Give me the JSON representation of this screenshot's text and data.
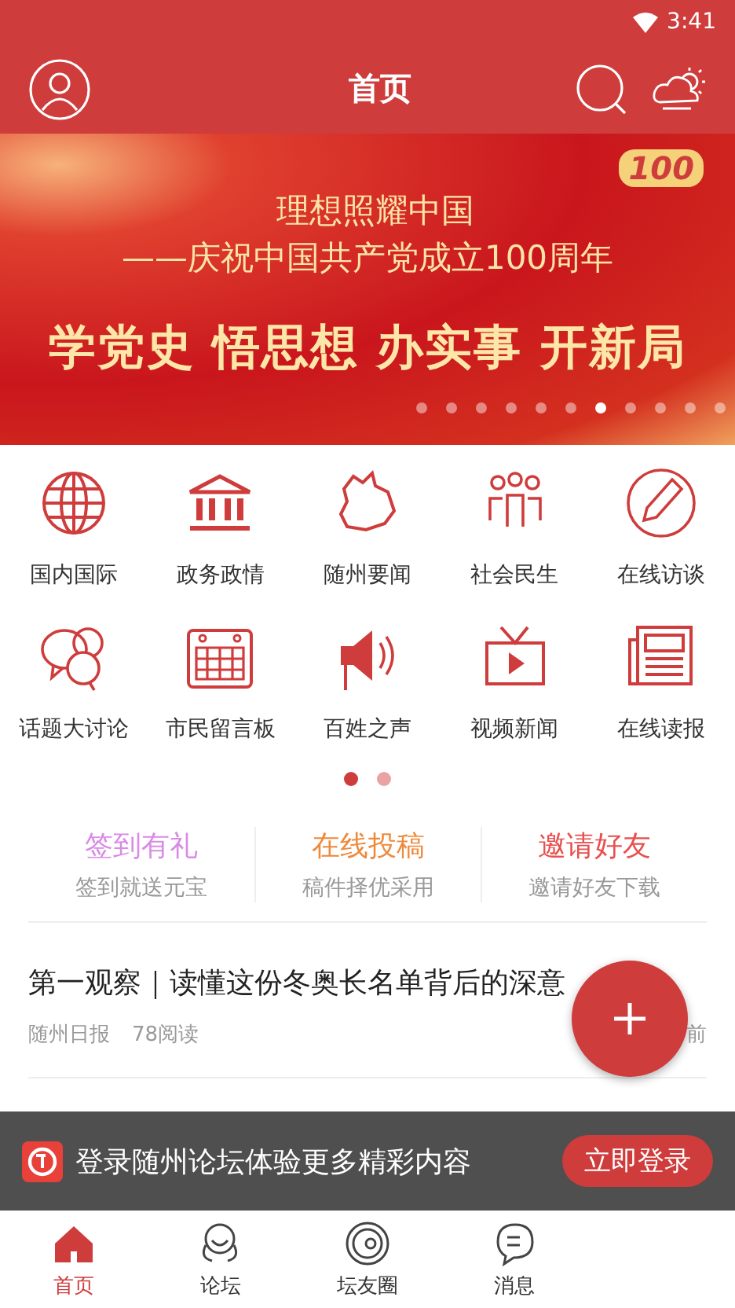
{
  "status_bar": {
    "time": "3:41"
  },
  "header": {
    "title": "首页"
  },
  "banner": {
    "line_1": "理想照耀中国",
    "line_2": "——庆祝中国共产党成立100周年",
    "slogan": "学党史 悟思想 办实事 开新局",
    "emblem": "100",
    "dots": [
      {
        "selected": false
      },
      {
        "selected": false
      },
      {
        "selected": false
      },
      {
        "selected": false
      },
      {
        "selected": false
      },
      {
        "selected": false
      },
      {
        "selected": true
      },
      {
        "selected": false
      },
      {
        "selected": false
      },
      {
        "selected": false
      },
      {
        "selected": false
      }
    ]
  },
  "channels": [
    {
      "label": "国内国际"
    },
    {
      "label": "政务政情"
    },
    {
      "label": "随州要闻"
    },
    {
      "label": "社会民生"
    },
    {
      "label": "在线访谈"
    },
    {
      "label": "话题大讨论"
    },
    {
      "label": "市民留言板"
    },
    {
      "label": "百姓之声"
    },
    {
      "label": "视频新闻"
    },
    {
      "label": "在线读报"
    }
  ],
  "channel_pages": [
    {
      "selected": true
    },
    {
      "selected": false
    }
  ],
  "quick_links": [
    {
      "title": "签到有礼",
      "subtitle": "签到就送元宝",
      "color": "#d98be6"
    },
    {
      "title": "在线投稿",
      "subtitle": "稿件择优采用",
      "color": "#ee8a3c"
    },
    {
      "title": "邀请好友",
      "subtitle": "邀请好友下载",
      "color": "#e84f4f"
    }
  ],
  "articles": [
    {
      "title": "第一观察｜读懂这份冬奥长名单背后的深意",
      "source": "随州日报",
      "reads": "78阅读",
      "time": "前"
    }
  ],
  "login_prompt": {
    "text": "登录随州论坛体验更多精彩内容",
    "button": "立即登录"
  },
  "tab_bar": [
    {
      "label": "首页",
      "selected": true
    },
    {
      "label": "论坛",
      "selected": false
    },
    {
      "label": "坛友圈",
      "selected": false
    },
    {
      "label": "消息",
      "selected": false
    }
  ]
}
